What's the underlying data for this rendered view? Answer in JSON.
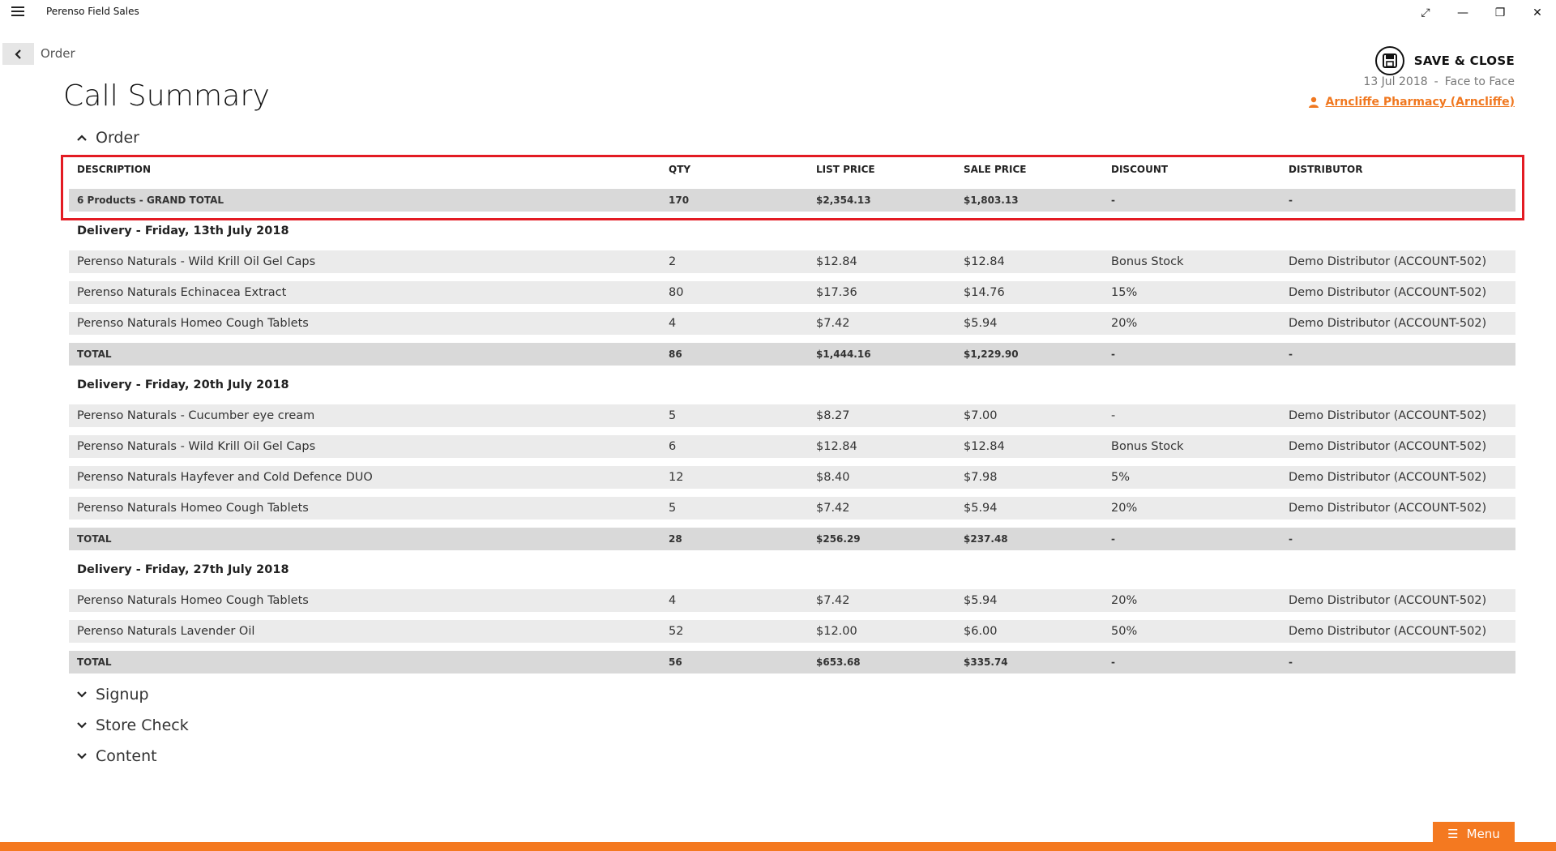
{
  "app": {
    "title": "Perenso Field Sales"
  },
  "nav": {
    "breadcrumb": "Order"
  },
  "page": {
    "title": "Call Summary"
  },
  "header_right": {
    "save_label": "SAVE & CLOSE",
    "date": "13 Jul 2018",
    "separator": "-",
    "call_type": "Face to Face",
    "customer": "Arncliffe Pharmacy (Arncliffe)"
  },
  "sections": {
    "order": "Order",
    "signup": "Signup",
    "store_check": "Store Check",
    "content": "Content"
  },
  "table": {
    "columns": [
      "DESCRIPTION",
      "QTY",
      "LIST PRICE",
      "SALE PRICE",
      "DISCOUNT",
      "DISTRIBUTOR"
    ],
    "grand_total": [
      "6 Products - GRAND TOTAL",
      "170",
      "$2,354.13",
      "$1,803.13",
      "-",
      "-"
    ],
    "groups": [
      {
        "title": "Delivery - Friday, 13th July 2018",
        "items": [
          [
            "Perenso Naturals - Wild Krill Oil Gel Caps",
            "2",
            "$12.84",
            "$12.84",
            "Bonus Stock",
            "Demo Distributor (ACCOUNT-502)"
          ],
          [
            "Perenso Naturals Echinacea Extract",
            "80",
            "$17.36",
            "$14.76",
            "15%",
            "Demo Distributor (ACCOUNT-502)"
          ],
          [
            "Perenso Naturals Homeo Cough Tablets",
            "4",
            "$7.42",
            "$5.94",
            "20%",
            "Demo Distributor (ACCOUNT-502)"
          ]
        ],
        "total": [
          "TOTAL",
          "86",
          "$1,444.16",
          "$1,229.90",
          "-",
          "-"
        ]
      },
      {
        "title": "Delivery - Friday, 20th July 2018",
        "items": [
          [
            "Perenso Naturals - Cucumber eye cream",
            "5",
            "$8.27",
            "$7.00",
            "-",
            "Demo Distributor (ACCOUNT-502)"
          ],
          [
            "Perenso Naturals - Wild Krill Oil Gel Caps",
            "6",
            "$12.84",
            "$12.84",
            "Bonus Stock",
            "Demo Distributor (ACCOUNT-502)"
          ],
          [
            "Perenso Naturals Hayfever and Cold Defence DUO",
            "12",
            "$8.40",
            "$7.98",
            "5%",
            "Demo Distributor (ACCOUNT-502)"
          ],
          [
            "Perenso Naturals Homeo Cough Tablets",
            "5",
            "$7.42",
            "$5.94",
            "20%",
            "Demo Distributor (ACCOUNT-502)"
          ]
        ],
        "total": [
          "TOTAL",
          "28",
          "$256.29",
          "$237.48",
          "-",
          "-"
        ]
      },
      {
        "title": "Delivery - Friday, 27th July 2018",
        "items": [
          [
            "Perenso Naturals Homeo Cough Tablets",
            "4",
            "$7.42",
            "$5.94",
            "20%",
            "Demo Distributor (ACCOUNT-502)"
          ],
          [
            "Perenso Naturals Lavender Oil",
            "52",
            "$12.00",
            "$6.00",
            "50%",
            "Demo Distributor (ACCOUNT-502)"
          ]
        ],
        "total": [
          "TOTAL",
          "56",
          "$653.68",
          "$335.74",
          "-",
          "-"
        ]
      }
    ]
  },
  "footer": {
    "menu_label": "Menu"
  },
  "colors": {
    "accent": "#f47920",
    "highlight": "#e31b23",
    "row_bg": "#ebebeb",
    "total_bg": "#d9d9d9"
  }
}
